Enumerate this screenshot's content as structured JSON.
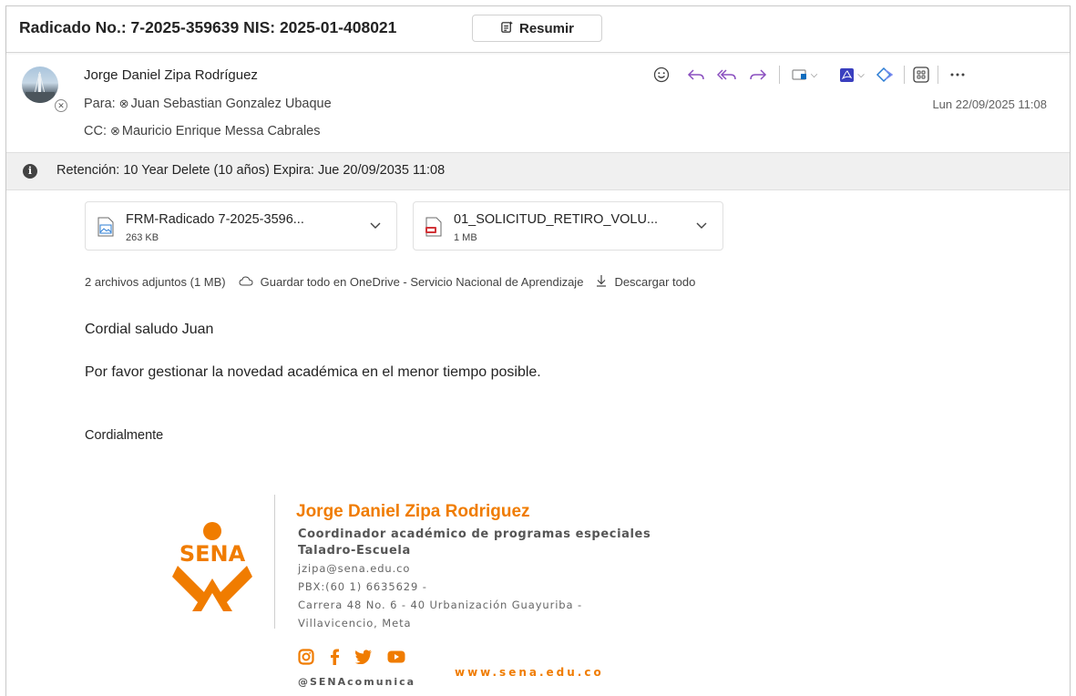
{
  "subject": {
    "title": "Radicado No.: 7-2025-359639 NIS: 2025-01-408021",
    "summarize_label": "Resumir"
  },
  "header": {
    "sender": "Jorge Daniel Zipa Rodríguez",
    "to_label": "Para:",
    "to": "Juan Sebastian Gonzalez Ubaque",
    "cc_label": "CC:",
    "cc": "Mauricio Enrique Messa Cabrales",
    "date": "Lun 22/09/2025 11:08"
  },
  "toolbar": {
    "icons": [
      "emoji-icon",
      "reply-icon",
      "reply-all-icon",
      "forward-icon",
      "label-icon",
      "pdf-icon",
      "loop-icon",
      "apps-icon",
      "more-icon"
    ]
  },
  "retention": {
    "text": "Retención: 10 Year Delete (10 años) Expira: Jue 20/09/2035 11:08"
  },
  "attachments": [
    {
      "name": "FRM-Radicado 7-2025-3596...",
      "size": "263 KB",
      "icon": "image-file-icon"
    },
    {
      "name": "01_SOLICITUD_RETIRO_VOLU...",
      "size": "1 MB",
      "icon": "pdf-file-icon"
    }
  ],
  "attachment_actions": {
    "summary": "2 archivos adjuntos (1 MB)",
    "save_onedrive": "Guardar todo en OneDrive - Servicio Nacional de Aprendizaje",
    "download_all": "Descargar todo"
  },
  "body": {
    "greeting": "Cordial saludo Juan",
    "request": "Por favor gestionar la novedad académica en el menor tiempo posible.",
    "closing": "Cordialmente"
  },
  "signature": {
    "logo_text": "SENA",
    "name": "Jorge Daniel Zipa Rodriguez",
    "role": "Coordinador académico de programas especiales",
    "school": "Taladro-Escuela",
    "email": "jzipa@sena.edu.co",
    "pbx": "PBX:(60 1) 6635629 -",
    "address1": "Carrera 48 No. 6 - 40 Urbanización Guayuriba -",
    "address2": "Villavicencio, Meta",
    "website": "www.sena.edu.co",
    "handle": "@SENAcomunica",
    "brand_color": "#f07c00"
  },
  "colors": {
    "accent": "#8a4fbf",
    "link_blue": "#0f6cbd",
    "retention_bg": "#f0f0f0"
  }
}
